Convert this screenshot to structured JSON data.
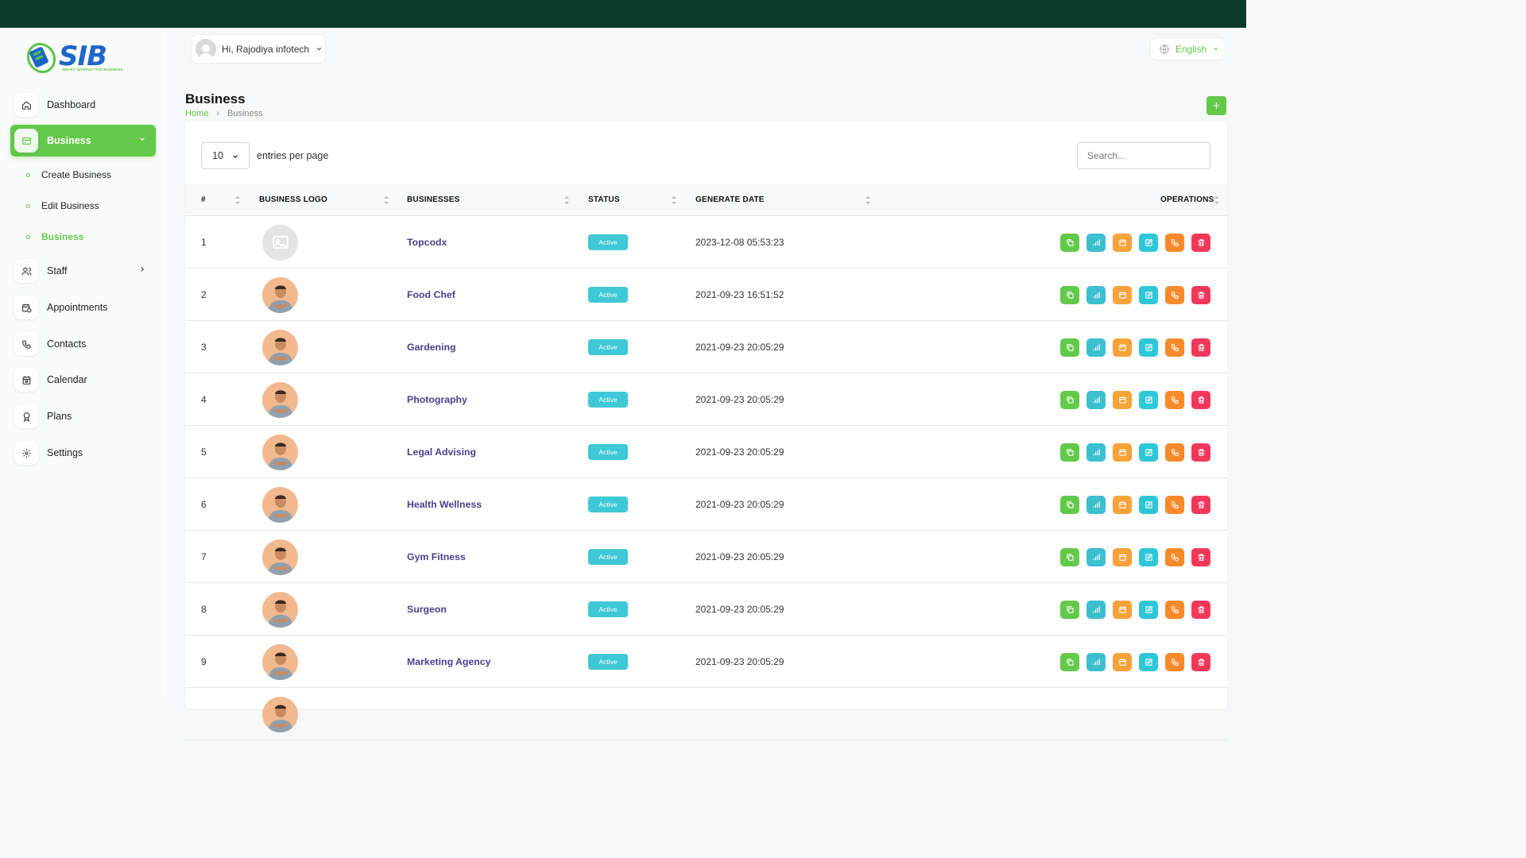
{
  "colors": {
    "brand_dark": "#0b3b2a",
    "accent": "#63c94a",
    "status_active": "#3fc8d6",
    "link": "#4a3f8f"
  },
  "logo": {
    "text": "SIB",
    "tagline": "SMART INTERACTIVE BUSINESS"
  },
  "header": {
    "greeting": "Hi, Rajodiya infotech",
    "language": "English"
  },
  "sidebar": {
    "items": [
      {
        "label": "Dashboard",
        "icon": "home-icon"
      },
      {
        "label": "Business",
        "icon": "credit-card-icon",
        "active": true,
        "expanded": true
      },
      {
        "label": "Staff",
        "icon": "users-icon"
      },
      {
        "label": "Appointments",
        "icon": "calendar-clock-icon"
      },
      {
        "label": "Contacts",
        "icon": "phone-icon"
      },
      {
        "label": "Calendar",
        "icon": "calendar-icon"
      },
      {
        "label": "Plans",
        "icon": "award-icon"
      },
      {
        "label": "Settings",
        "icon": "gear-icon"
      }
    ],
    "business_sub": [
      {
        "label": "Create Business"
      },
      {
        "label": "Edit Business"
      },
      {
        "label": "Business",
        "active": true
      }
    ]
  },
  "page": {
    "title": "Business",
    "breadcrumb": {
      "home": "Home",
      "current": "Business"
    },
    "add_label": "+"
  },
  "table": {
    "entries_value": "10",
    "entries_label": "entries per page",
    "search_placeholder": "Search...",
    "headers": {
      "num": "#",
      "logo": "BUSINESS LOGO",
      "name": "BUSINESSES",
      "status": "STATUS",
      "date": "GENERATE DATE",
      "ops": "OPERATIONS"
    },
    "rows": [
      {
        "num": "1",
        "name": "Topcodx",
        "status": "Active",
        "date": "2023-12-08 05:53:23",
        "logo": "placeholder"
      },
      {
        "num": "2",
        "name": "Food Chef",
        "status": "Active",
        "date": "2021-09-23 16:51:52",
        "logo": "person"
      },
      {
        "num": "3",
        "name": "Gardening",
        "status": "Active",
        "date": "2021-09-23 20:05:29",
        "logo": "person"
      },
      {
        "num": "4",
        "name": "Photography",
        "status": "Active",
        "date": "2021-09-23 20:05:29",
        "logo": "person"
      },
      {
        "num": "5",
        "name": "Legal Advising",
        "status": "Active",
        "date": "2021-09-23 20:05:29",
        "logo": "person"
      },
      {
        "num": "6",
        "name": "Health Wellness",
        "status": "Active",
        "date": "2021-09-23 20:05:29",
        "logo": "person"
      },
      {
        "num": "7",
        "name": "Gym Fitness",
        "status": "Active",
        "date": "2021-09-23 20:05:29",
        "logo": "person"
      },
      {
        "num": "8",
        "name": "Surgeon",
        "status": "Active",
        "date": "2021-09-23 20:05:29",
        "logo": "person"
      },
      {
        "num": "9",
        "name": "Marketing Agency",
        "status": "Active",
        "date": "2021-09-23 20:05:29",
        "logo": "person"
      }
    ],
    "operations": [
      {
        "icon": "copy-icon",
        "color": "green"
      },
      {
        "icon": "analytics-icon",
        "color": "teal"
      },
      {
        "icon": "calendar-icon",
        "color": "amber"
      },
      {
        "icon": "edit-icon",
        "color": "cyan"
      },
      {
        "icon": "phone-icon",
        "color": "orange"
      },
      {
        "icon": "trash-icon",
        "color": "red"
      }
    ]
  }
}
